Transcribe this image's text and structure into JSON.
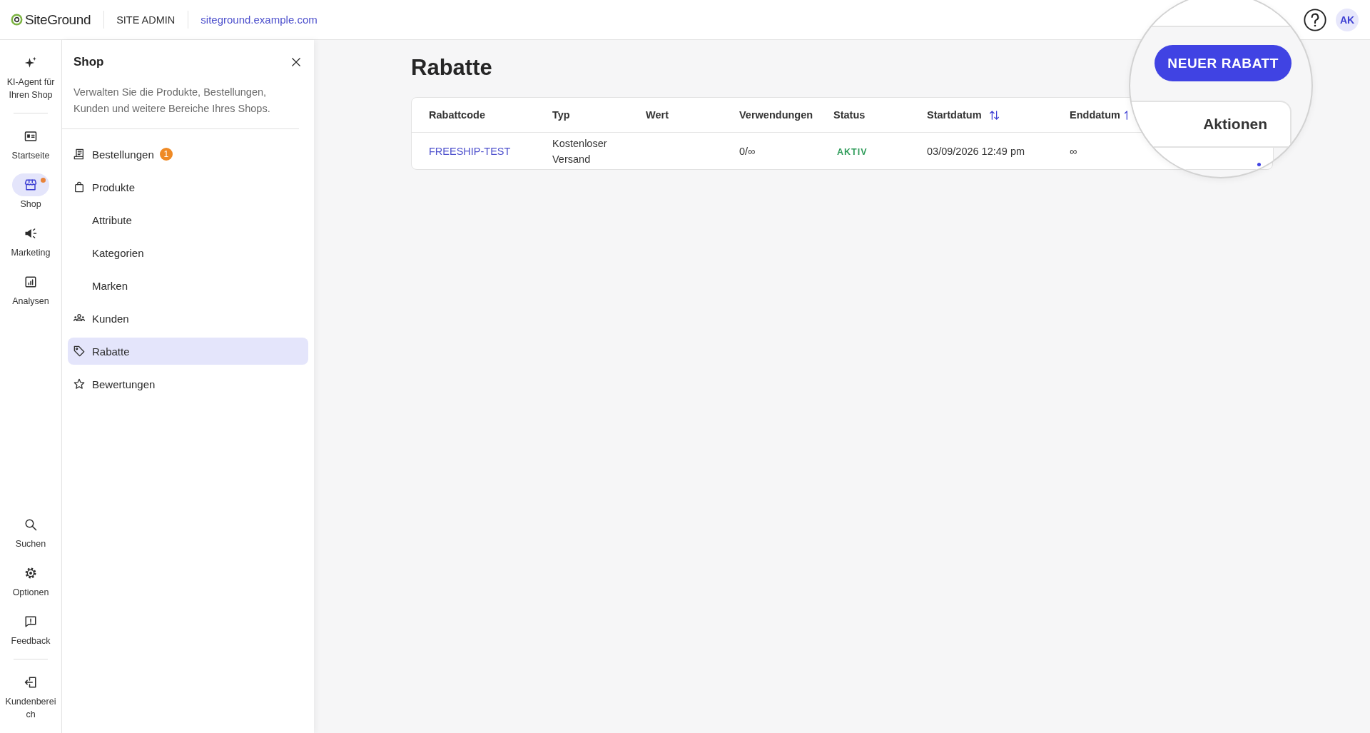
{
  "header": {
    "logo": "SiteGround",
    "section": "SITE ADMIN",
    "site_link": "siteground.example.com",
    "avatar": "AK"
  },
  "rail": {
    "items": [
      {
        "label": "KI-Agent für Ihren Shop",
        "selected": false,
        "unread": false
      },
      {
        "label": "Startseite",
        "selected": false,
        "unread": false
      },
      {
        "label": "Shop",
        "selected": true,
        "unread": true
      },
      {
        "label": "Marketing",
        "selected": false,
        "unread": false
      },
      {
        "label": "Analysen",
        "selected": false,
        "unread": false
      }
    ],
    "bottom_items": [
      {
        "label": "Suchen",
        "selected": false,
        "unread": false
      },
      {
        "label": "Optionen",
        "selected": false,
        "unread": false
      },
      {
        "label": "Feedback",
        "selected": false,
        "unread": false
      },
      {
        "label": "Kundenbereich",
        "selected": false,
        "unread": false
      }
    ]
  },
  "panel": {
    "title": "Shop",
    "description": "Verwalten Sie die Produkte, Bestellungen, Kunden und weitere Bereiche Ihres Shops.",
    "items": [
      {
        "label": "Bestellungen",
        "selected": false,
        "badge": "1"
      },
      {
        "label": "Produkte",
        "selected": false,
        "children": [
          {
            "label": "Attribute",
            "selected": false
          },
          {
            "label": "Kategorien",
            "selected": false
          },
          {
            "label": "Marken",
            "selected": false
          }
        ]
      },
      {
        "label": "Kunden",
        "selected": false
      },
      {
        "label": "Rabatte",
        "selected": true
      },
      {
        "label": "Bewertungen",
        "selected": false
      }
    ]
  },
  "main": {
    "title": "Rabatte",
    "table": {
      "columns": [
        {
          "label": "Rabattcode",
          "sortable": false
        },
        {
          "label": "Typ",
          "sortable": false
        },
        {
          "label": "Wert",
          "sortable": false
        },
        {
          "label": "Verwendungen",
          "sortable": false
        },
        {
          "label": "Status",
          "sortable": false
        },
        {
          "label": "Startdatum",
          "sortable": true
        },
        {
          "label": "Enddatum",
          "sortable": true
        }
      ],
      "rows": [
        {
          "code": "FREESHIP-TEST",
          "type": "Kostenloser Versand",
          "uses": "0/∞",
          "status": "AKTIV",
          "start": "03/09/2026 12:49 pm",
          "end": "∞"
        }
      ]
    }
  },
  "magnifier": {
    "button": "NEUER RABATT",
    "column": "Aktionen"
  }
}
